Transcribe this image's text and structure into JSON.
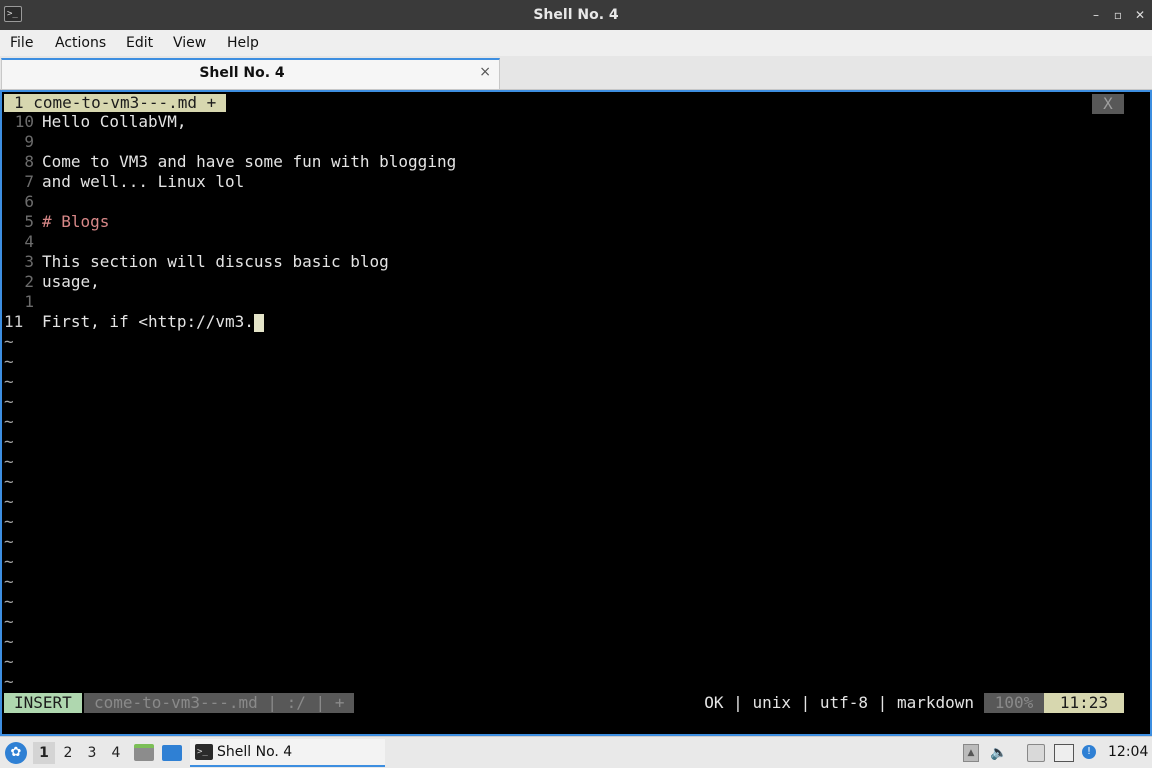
{
  "window": {
    "title": "Shell No. 4",
    "app_icon": "terminal-icon",
    "controls": {
      "minimize": "–",
      "maximize": "▫",
      "close": "✕"
    }
  },
  "menu": [
    "File",
    "Actions",
    "Edit",
    "View",
    "Help"
  ],
  "tab": {
    "label": "Shell No. 4",
    "close": "×"
  },
  "vim": {
    "buffer_tab": "1 come-to-vm3---.md +",
    "buffer_close": "X",
    "lines": [
      {
        "num": "10",
        "text": "Hello CollabVM,",
        "style": "normal"
      },
      {
        "num": "9",
        "text": "",
        "style": "normal"
      },
      {
        "num": "8",
        "text": "Come to VM3 and have some fun with blogging",
        "style": "normal"
      },
      {
        "num": "7",
        "text": "and well... Linux lol",
        "style": "normal"
      },
      {
        "num": "6",
        "text": "",
        "style": "normal"
      },
      {
        "num": "5",
        "text": "# Blogs",
        "style": "heading"
      },
      {
        "num": "4",
        "text": "",
        "style": "normal"
      },
      {
        "num": "3",
        "text": "This section will discuss basic blog",
        "style": "normal"
      },
      {
        "num": "2",
        "text": "usage,",
        "style": "normal"
      },
      {
        "num": "1",
        "text": "",
        "style": "normal"
      },
      {
        "num": "11",
        "text": "First, if <http://vm3.",
        "style": "current"
      }
    ],
    "empty_marker": "~",
    "empty_count": 18,
    "status": {
      "mode": "INSERT",
      "file": "come-to-vm3---.md | :/ | +",
      "info": "OK | unix | utf-8 | markdown",
      "percent": "100%",
      "position": "11:23"
    }
  },
  "taskbar": {
    "start_icon": "lxqt-start-icon",
    "workspaces": [
      "1",
      "2",
      "3",
      "4"
    ],
    "active_workspace": "1",
    "task_label": "Shell No. 4",
    "tray_icons": [
      "expand-tray-icon",
      "volume-icon",
      "clipboard-icon",
      "network-icon",
      "update-notifier-icon"
    ],
    "clock": "12:04"
  }
}
